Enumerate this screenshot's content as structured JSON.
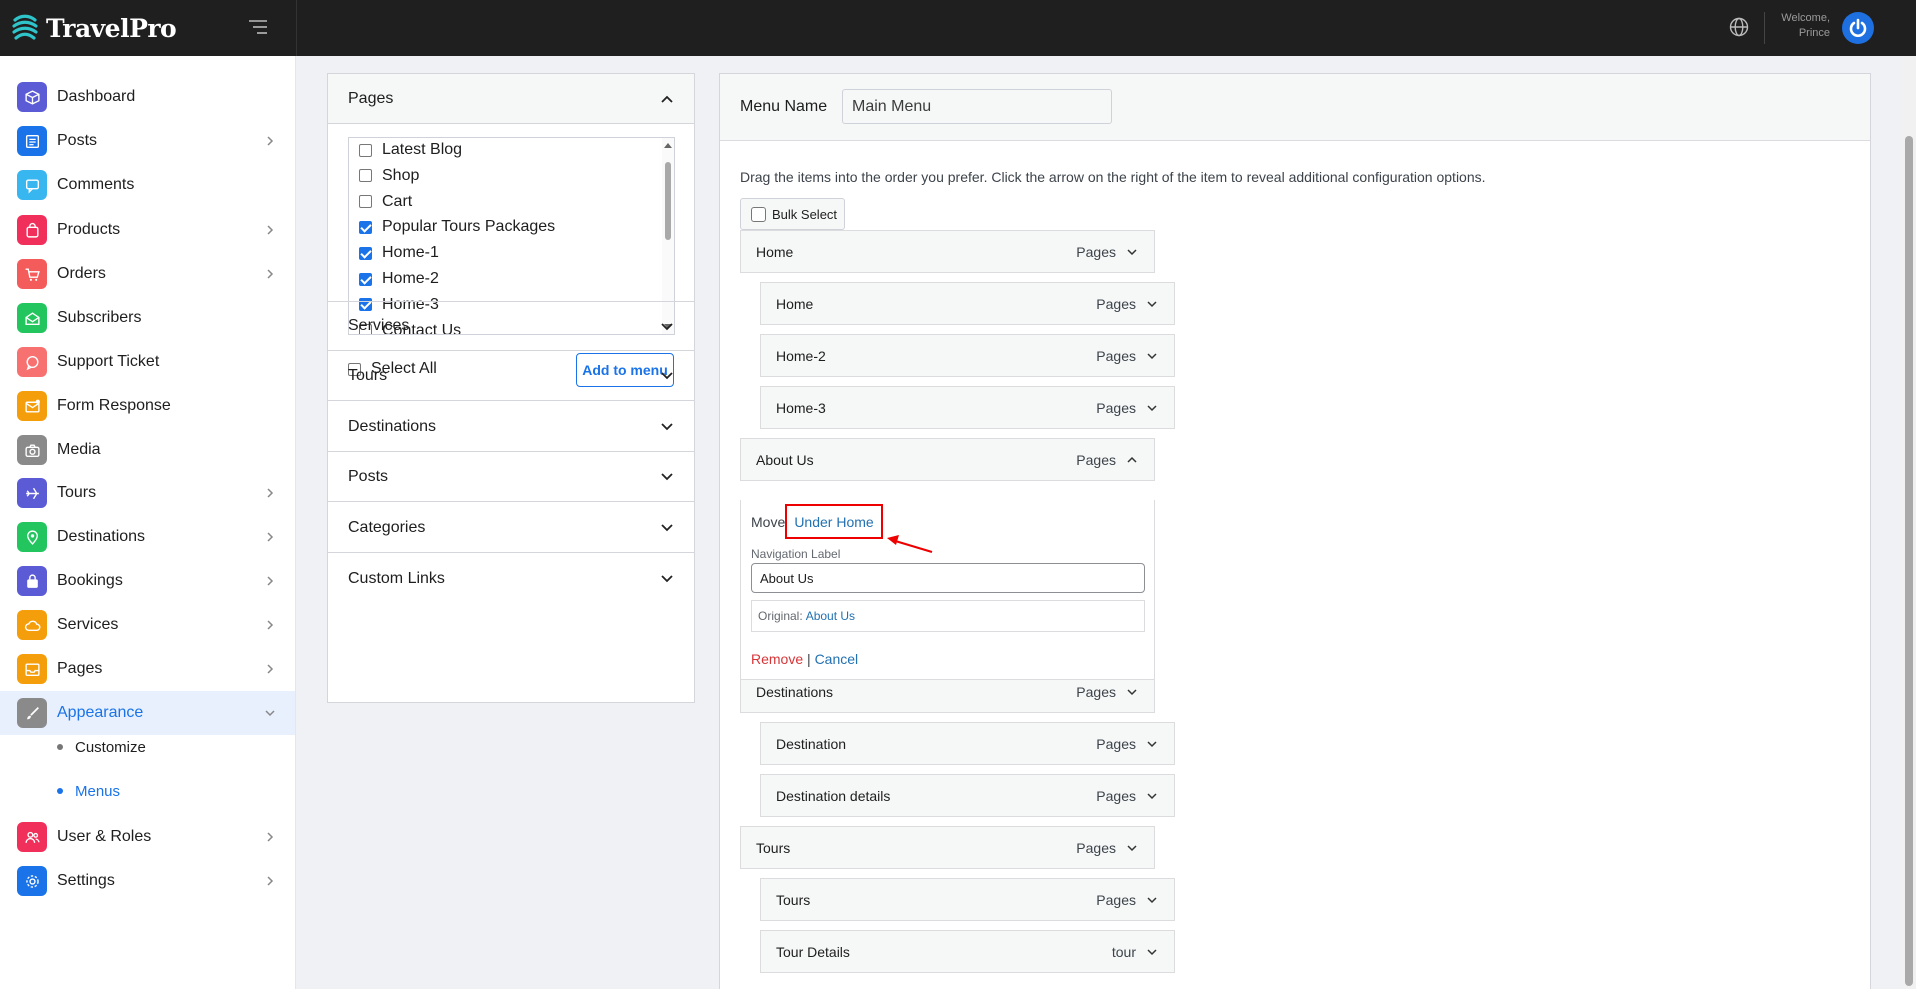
{
  "app": {
    "name": "TravelPro",
    "welcome": "Welcome,",
    "user": "Prince"
  },
  "sidebar": {
    "items": [
      {
        "label": "Dashboard",
        "icon": "cube-icon",
        "color": "#5b5bd6",
        "chevron": false
      },
      {
        "label": "Posts",
        "icon": "newspaper-icon",
        "color": "#1a73e8",
        "chevron": true
      },
      {
        "label": "Comments",
        "icon": "chat-icon",
        "color": "#38b6f0",
        "chevron": false
      },
      {
        "label": "Products",
        "icon": "bag-icon",
        "color": "#f0305a",
        "chevron": true
      },
      {
        "label": "Orders",
        "icon": "cart-icon",
        "color": "#f45b5b",
        "chevron": true
      },
      {
        "label": "Subscribers",
        "icon": "envelope-open-icon",
        "color": "#22c55e",
        "chevron": false
      },
      {
        "label": "Support Ticket",
        "icon": "chat-bubble-icon",
        "color": "#f87171",
        "chevron": false
      },
      {
        "label": "Form Response",
        "icon": "mail-icon",
        "color": "#f59e0b",
        "chevron": false
      },
      {
        "label": "Media",
        "icon": "camera-icon",
        "color": "#8a8a8a",
        "chevron": false
      },
      {
        "label": "Tours",
        "icon": "plane-icon",
        "color": "#5b5bd6",
        "chevron": true
      },
      {
        "label": "Destinations",
        "icon": "map-pin-icon",
        "color": "#22c55e",
        "chevron": true
      },
      {
        "label": "Bookings",
        "icon": "lock-bag-icon",
        "color": "#5b5bd6",
        "chevron": true
      },
      {
        "label": "Services",
        "icon": "cloud-icon",
        "color": "#f59e0b",
        "chevron": true
      },
      {
        "label": "Pages",
        "icon": "inbox-icon",
        "color": "#f59e0b",
        "chevron": true
      },
      {
        "label": "Appearance",
        "icon": "brush-icon",
        "color": "#8a8a8a",
        "chevron": true,
        "active": true
      },
      {
        "label": "User & Roles",
        "icon": "users-icon",
        "color": "#f0305a",
        "chevron": true
      },
      {
        "label": "Settings",
        "icon": "gear-icon",
        "color": "#1a73e8",
        "chevron": true
      }
    ],
    "appearance_sub": [
      {
        "label": "Customize",
        "active": false
      },
      {
        "label": "Menus",
        "active": true
      }
    ]
  },
  "left_panel": {
    "pages_header": "Pages",
    "pages_list": [
      {
        "label": "Latest Blog",
        "checked": false
      },
      {
        "label": "Shop",
        "checked": false
      },
      {
        "label": "Cart",
        "checked": false
      },
      {
        "label": "Popular Tours Packages",
        "checked": true
      },
      {
        "label": "Home-1",
        "checked": true
      },
      {
        "label": "Home-2",
        "checked": true
      },
      {
        "label": "Home-3",
        "checked": true
      },
      {
        "label": "Contact Us",
        "checked": false
      }
    ],
    "select_all": "Select All",
    "add_to_menu": "Add to menu",
    "sections": [
      "Services",
      "Tours",
      "Destinations",
      "Posts",
      "Categories",
      "Custom Links"
    ]
  },
  "right_panel": {
    "menu_name_label": "Menu Name",
    "menu_name_value": "Main Menu",
    "instructions": "Drag the items into the order you prefer. Click the arrow on the right of the item to reveal additional configuration options.",
    "bulk_select": "Bulk Select",
    "menu_items": [
      {
        "label": "Home",
        "type": "Pages",
        "depth": 0
      },
      {
        "label": "Home",
        "type": "Pages",
        "depth": 1
      },
      {
        "label": "Home-2",
        "type": "Pages",
        "depth": 1
      },
      {
        "label": "Home-3",
        "type": "Pages",
        "depth": 1
      },
      {
        "label": "About Us",
        "type": "Pages",
        "depth": 0,
        "expanded": true
      },
      {
        "label": "Destinations",
        "type": "Pages",
        "depth": 0
      },
      {
        "label": "Destination",
        "type": "Pages",
        "depth": 1
      },
      {
        "label": "Destination details",
        "type": "Pages",
        "depth": 1
      },
      {
        "label": "Tours",
        "type": "Pages",
        "depth": 0
      },
      {
        "label": "Tours",
        "type": "Pages",
        "depth": 1
      },
      {
        "label": "Tour Details",
        "type": "tour",
        "depth": 1
      }
    ],
    "about_settings": {
      "move_label": "Move",
      "under_home": "Under Home",
      "nav_label_caption": "Navigation Label",
      "nav_label_value": "About Us",
      "original_label": "Original:",
      "original_link": "About Us",
      "remove": "Remove",
      "separator": "|",
      "cancel": "Cancel"
    }
  },
  "colors": {
    "accent": "#1a73e8",
    "highlight_box": "#ee0000",
    "remove": "#d63638",
    "link": "#2271b1"
  }
}
